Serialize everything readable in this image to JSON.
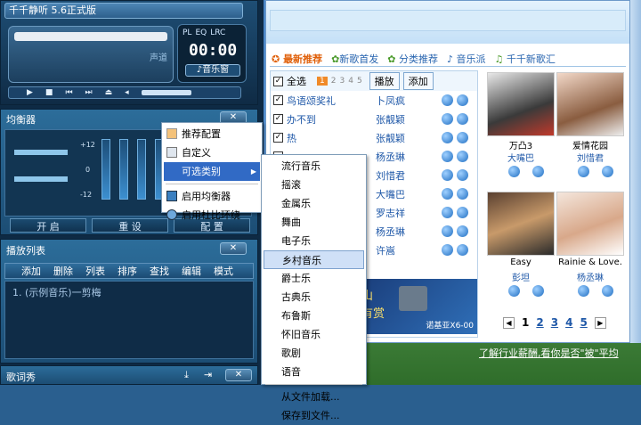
{
  "player": {
    "title": "千千静听 5.6正式版",
    "balance_label": "声道",
    "mode_buttons": [
      "PL",
      "EQ",
      "LRC"
    ],
    "time": "00:00",
    "window_button": "♪音乐窗"
  },
  "equalizer": {
    "title": "均衡器",
    "close_label": "✕",
    "scale": [
      "+12",
      "0",
      "-12"
    ],
    "buttons": [
      "开 启",
      "重 设",
      "配 置"
    ]
  },
  "playlist": {
    "title": "播放列表",
    "close_label": "✕",
    "toolbar": [
      "添加",
      "删除",
      "列表",
      "排序",
      "查找",
      "编辑",
      "模式"
    ],
    "items": [
      {
        "text": "1. (示例音乐)一剪梅"
      }
    ]
  },
  "lyrics": {
    "title": "歌词秀",
    "close_label": "✕"
  },
  "context_menu": {
    "items": [
      "推荐配置",
      "自定义",
      "可选类别",
      "启用均衡器",
      "启用杜比环绕"
    ]
  },
  "submenu": {
    "items": [
      "流行音乐",
      "摇滚",
      "金属乐",
      "舞曲",
      "电子乐",
      "乡村音乐",
      "爵士乐",
      "古典乐",
      "布鲁斯",
      "怀旧音乐",
      "歌剧",
      "语音"
    ],
    "file_items": [
      "从文件加载...",
      "保存到文件..."
    ],
    "selected": "乡村音乐"
  },
  "browser": {
    "tabs": [
      "最新推荐",
      "新歌首发",
      "分类推荐",
      "音乐派",
      "千千新歌汇"
    ],
    "select_all": "全选",
    "pages_mini": [
      "1",
      "2",
      "3",
      "4",
      "5"
    ],
    "play_button": "播放",
    "add_button": "添加",
    "songs": [
      {
        "name": "鸟语颂奖礼",
        "artist": "卜凤疯"
      },
      {
        "name": "办不到",
        "artist": "张靓颖"
      },
      {
        "name": "热",
        "artist": "张靓颖"
      },
      {
        "name": "",
        "artist": "杨丞琳"
      },
      {
        "name": "",
        "artist": "刘惜君"
      },
      {
        "name": "",
        "artist": "大嘴巴"
      },
      {
        "name": "",
        "artist": "罗志祥"
      },
      {
        "name": "",
        "artist": "杨丞琳"
      },
      {
        "name": "",
        "artist": "许嵩"
      }
    ],
    "albums": [
      {
        "title": "万凸3",
        "artist": "大嘴巴"
      },
      {
        "title": "爱情花园",
        "artist": "刘惜君"
      },
      {
        "title": "Easy",
        "artist": "彭坦"
      },
      {
        "title": "Rainie & Love.",
        "artist": "杨丞琳"
      }
    ],
    "pages": [
      "1",
      "2",
      "3",
      "4",
      "5"
    ],
    "banner_text": "诺基亚X6-00",
    "banner_slogan": "有赏",
    "banner_slogan2": "山",
    "bottom_link": "了解行业薪酬,看你是否\"被\"平均"
  }
}
